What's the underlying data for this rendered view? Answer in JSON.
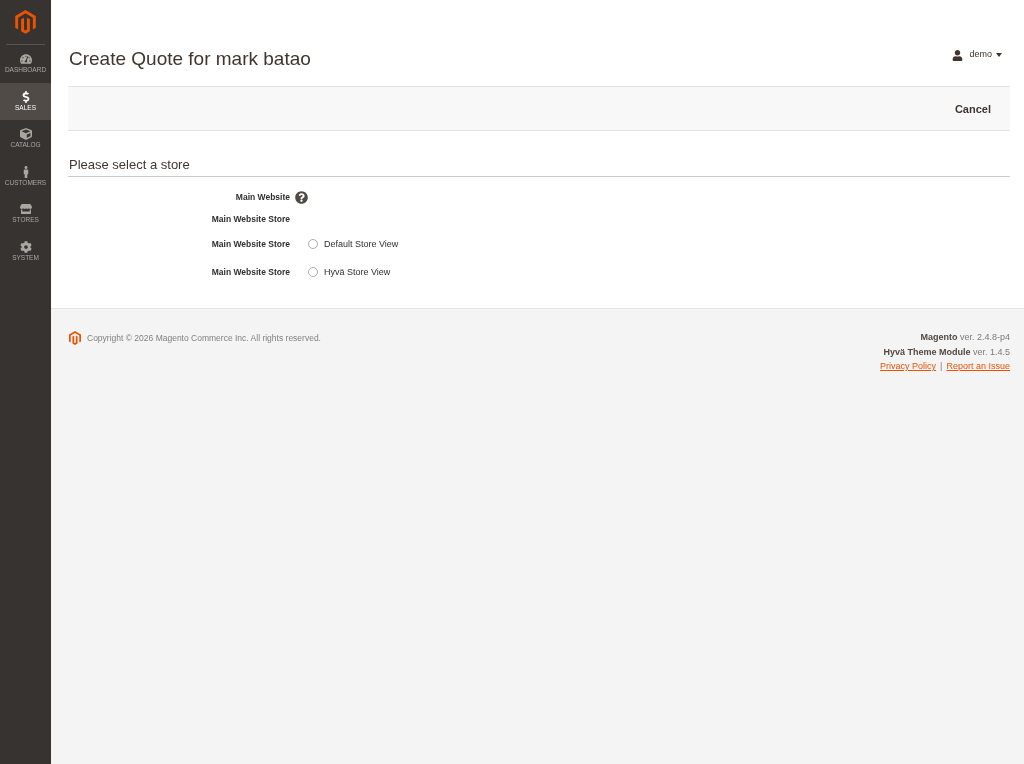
{
  "sidebar": {
    "items": [
      {
        "label": "DASHBOARD",
        "selected": false
      },
      {
        "label": "SALES",
        "selected": true
      },
      {
        "label": "CATALOG",
        "selected": false
      },
      {
        "label": "CUSTOMERS",
        "selected": false
      },
      {
        "label": "STORES",
        "selected": false
      },
      {
        "label": "SYSTEM",
        "selected": false
      }
    ]
  },
  "header": {
    "title": "Create Quote for mark batao",
    "user": "demo"
  },
  "page_actions": {
    "buttons": [
      "Cancel"
    ]
  },
  "store_selection": {
    "title": "Please select a store",
    "rows": [
      {
        "kind": "website",
        "label": "Main Website"
      },
      {
        "kind": "store_group",
        "label": "Main Website Store"
      },
      {
        "kind": "store_view",
        "label": "Main Website Store",
        "option": "Default Store View",
        "selected": false
      },
      {
        "kind": "store_view",
        "label": "Main Website Store",
        "option": "Hyvä Store View",
        "selected": false
      }
    ]
  },
  "footer": {
    "copyright": "Copyright © 2026 Magento Commerce Inc. All rights reserved.",
    "versions": [
      "**Magento** ver. 2.4.8-p4",
      "**Hyvä Theme Module** ver. 1.4.5"
    ],
    "links": [
      "Privacy Policy",
      "Report an Issue"
    ],
    "link_separator": "|"
  }
}
